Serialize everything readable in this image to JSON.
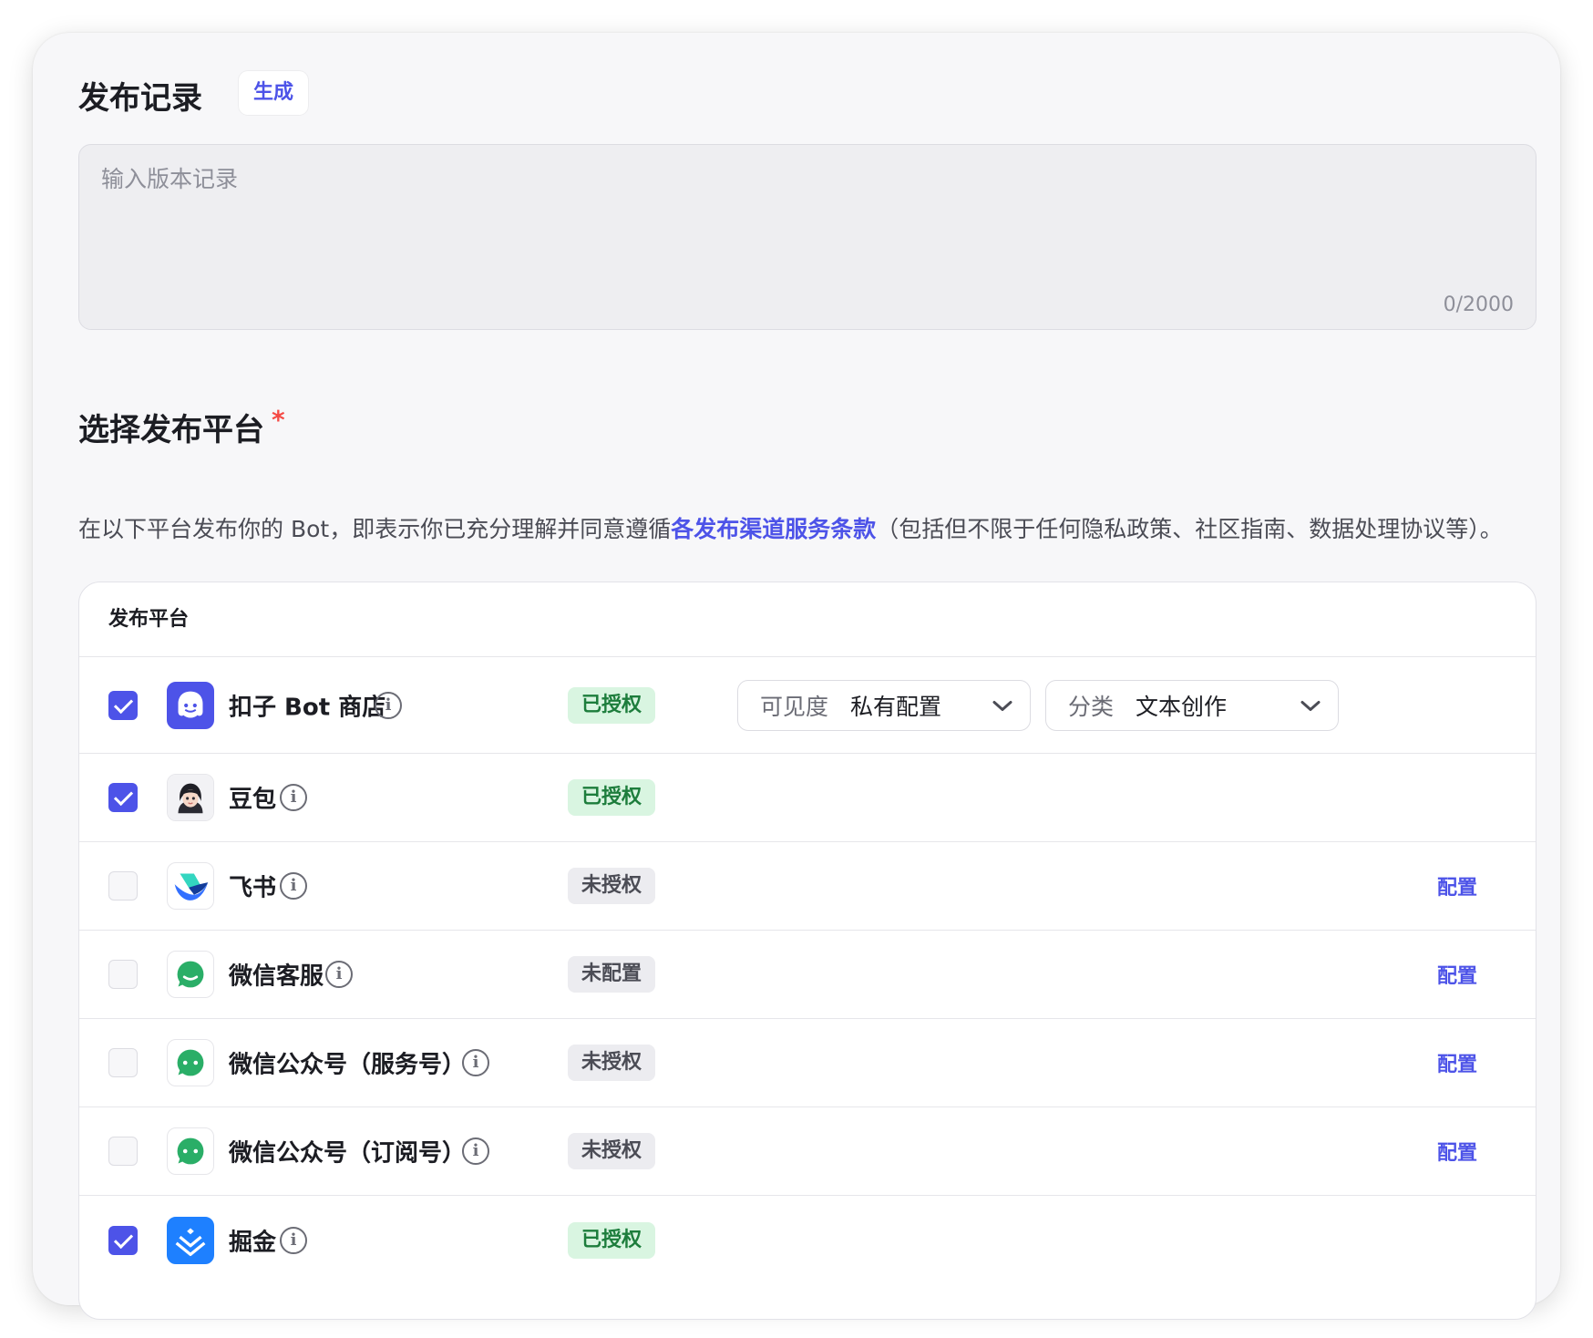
{
  "release_notes": {
    "title": "发布记录",
    "generate_label": "生成",
    "placeholder": "输入版本记录",
    "value": "",
    "counter": "0/2000"
  },
  "platform_section": {
    "title": "选择发布平台",
    "required_mark": "*",
    "description_prefix": "在以下平台发布你的 Bot，即表示你已充分理解并同意遵循",
    "terms_link": "各发布渠道服务条款",
    "description_suffix": "（包括但不限于任何隐私政策、社区指南、数据处理协议等）。"
  },
  "table": {
    "header": "发布平台",
    "rows": [
      {
        "name": "扣子 Bot 商店",
        "status": "已授权",
        "checked": true,
        "icon": "coze-store-icon"
      },
      {
        "name": "豆包",
        "status": "已授权",
        "checked": true,
        "icon": "doubao-avatar-icon"
      },
      {
        "name": "飞书",
        "status": "未授权",
        "checked": false,
        "icon": "feishu-icon",
        "action": "配置"
      },
      {
        "name": "微信客服",
        "status": "未配置",
        "checked": false,
        "icon": "wechat-service-icon",
        "action": "配置"
      },
      {
        "name": "微信公众号（服务号）",
        "status": "未授权",
        "checked": false,
        "icon": "wechat-icon",
        "action": "配置"
      },
      {
        "name": "微信公众号（订阅号）",
        "status": "未授权",
        "checked": false,
        "icon": "wechat-icon",
        "action": "配置"
      },
      {
        "name": "掘金",
        "status": "已授权",
        "checked": true,
        "icon": "juejin-icon"
      }
    ],
    "visibility": {
      "label": "可见度",
      "value": "私有配置"
    },
    "category": {
      "label": "分类",
      "value": "文本创作"
    }
  },
  "colors": {
    "accent": "#4d53e8",
    "authorized_bg": "#d9f5e1",
    "authorized_text": "#1d7d3c",
    "unauthorized_bg": "#ececf0",
    "required": "#f54a45"
  }
}
